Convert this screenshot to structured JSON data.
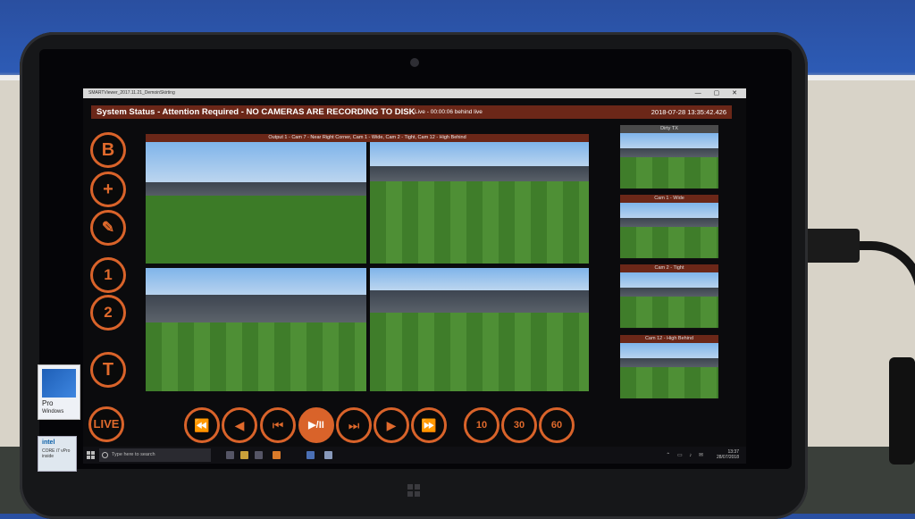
{
  "window": {
    "title": "SMARTViewer_2017.11.21_DemoinSkirting",
    "controls": "— ▢ ✕"
  },
  "status": {
    "message": "System Status - Attention Required - NO CAMERAS ARE RECORDING TO DISK",
    "live_offset": "Live - 00:00:06 behind live",
    "timestamp": "2018-07-28 13:35:42.426"
  },
  "side_buttons": [
    {
      "label": "B"
    },
    {
      "label": "+"
    },
    {
      "label": "✎"
    },
    {
      "label": "1"
    },
    {
      "label": "2"
    },
    {
      "label": "T"
    },
    {
      "label": "LIVE"
    }
  ],
  "output": {
    "header": "Output 1 - Cam 7 - Near Right Corner, Cam 1 - Wide, Cam 2 - Tight, Cam 12 - High Behind"
  },
  "thumbnails": [
    {
      "label": "Dirty TX"
    },
    {
      "label": "Cam 1 - Wide"
    },
    {
      "label": "Cam 2 - Tight"
    },
    {
      "label": "Cam 12 - High Behind"
    }
  ],
  "playback": {
    "rewind": "⏪",
    "prev": "◀",
    "start": "⏮",
    "play_pause": "▶/II",
    "end": "⏭",
    "next": "▶",
    "fast_forward": "⏩",
    "skip10": "10",
    "skip30": "30",
    "skip60": "60"
  },
  "taskbar": {
    "search_placeholder": "Type here to search",
    "time": "13:37",
    "date": "28/07/2018"
  },
  "stickers": {
    "windows_pro": "Pro",
    "windows_name": "Windows",
    "intel": "intel",
    "intel_cpu": "CORE i7 vPro inside"
  },
  "colors": {
    "accent": "#d9632a",
    "status_bar": "#6b2718"
  }
}
